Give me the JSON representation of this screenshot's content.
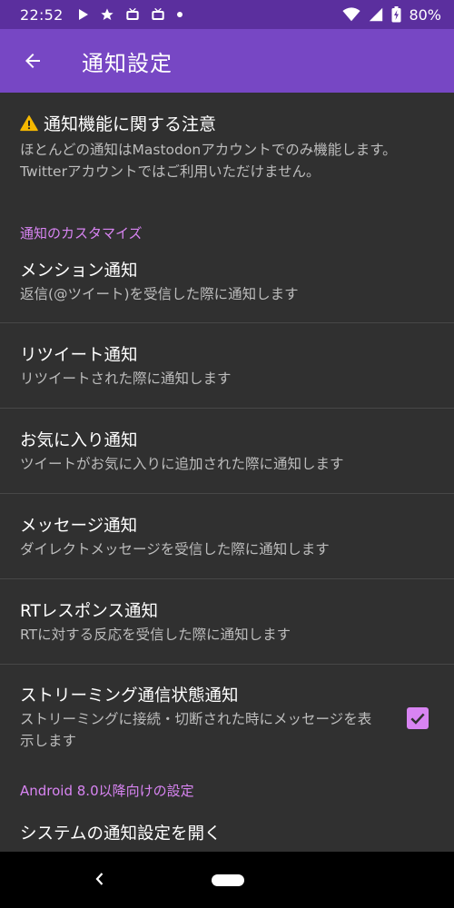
{
  "status_bar": {
    "time": "22:52",
    "battery": "80%",
    "notification_icons": [
      "play-icon",
      "star-icon",
      "tv-icon",
      "tv-icon",
      "dot-icon"
    ],
    "system_icons": [
      "wifi-icon",
      "signal-icon",
      "battery-icon"
    ]
  },
  "app_bar": {
    "title": "通知設定",
    "back_icon": "arrow-back-icon"
  },
  "notice": {
    "title": "通知機能に関する注意",
    "body": "ほとんどの通知はMastodonアカウントでのみ機能します。Twitterアカウントではご利用いただけません。"
  },
  "categories": {
    "customize": "通知のカスタマイズ",
    "android": "Android 8.0以降向けの設定"
  },
  "prefs": [
    {
      "title": "メンション通知",
      "summary": "返信(@ツイート)を受信した際に通知します"
    },
    {
      "title": "リツイート通知",
      "summary": "リツイートされた際に通知します"
    },
    {
      "title": "お気に入り通知",
      "summary": "ツイートがお気に入りに追加された際に通知します"
    },
    {
      "title": "メッセージ通知",
      "summary": "ダイレクトメッセージを受信した際に通知します"
    },
    {
      "title": "RTレスポンス通知",
      "summary": "RTに対する反応を受信した際に通知します"
    },
    {
      "title": "ストリーミング通信状態通知",
      "summary": "ストリーミングに接続・切断された時にメッセージを表示します",
      "checked": true
    }
  ],
  "partial_item": "システムの通知設定を開く",
  "colors": {
    "accent": "#d884f2",
    "app_bar": "#7747c4",
    "status_bar": "#5b2f9e",
    "background": "#303030"
  }
}
